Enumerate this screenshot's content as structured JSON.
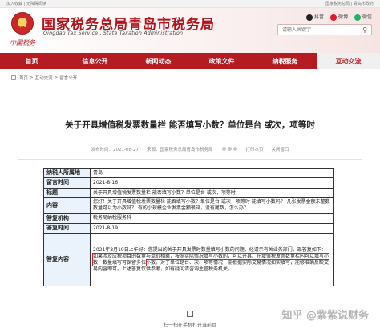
{
  "topbar": {
    "left": "加入收藏 | 无障碍阅读",
    "right": "国家税务总局 | 青岛市政府"
  },
  "header": {
    "emblem_char": "税",
    "title": "国家税务总局青岛市税务局",
    "subtitle": "Qingdao Tax Service , State Taxation Administration",
    "slogan": "中国税务",
    "social": [
      "抖音",
      "微博",
      "微信"
    ],
    "search_placeholder": "请输入关键字"
  },
  "nav": [
    "首页",
    "信息公开",
    "新闻动态",
    "政策文件",
    "纳税服务",
    "互动交流"
  ],
  "nav_active": 5,
  "breadcrumb": [
    "首页",
    ">",
    "互动交流",
    ">",
    "留言公开"
  ],
  "article": {
    "title": "关于开具增值税发票数量栏 能否填写小数？单位是台 或次，项等时",
    "date": "发布时间：2021-08-27",
    "source": "来源：国家税务总局青岛市税务局",
    "print": "打印本页",
    "close": "关闭窗口"
  },
  "table": [
    {
      "k": "纳税人所属地",
      "v": "青岛"
    },
    {
      "k": "留言时间",
      "v": "2021-8-16"
    },
    {
      "k": "标题",
      "v": "关于开具增值税发票数量栏 能否填写小数？单位是台 或次，项等时"
    },
    {
      "k": "内容",
      "v": "您好！关于开具增值税发票数量栏 能否填写小数？单位是台 或次，项等时 能填写小数吗？ 几张发票金额未整数数量可以为小数吗？ 有的小规模企业发票金额很碎，没有尾数，怎么办？"
    },
    {
      "k": "答复机构",
      "v": "税务局纳税服务科"
    },
    {
      "k": "答复时间",
      "v": "2021-8-19"
    },
    {
      "k": "答复内容",
      "v_pre": "2021年8月19日上午好：您提出的关于开具发票时数量填写小数的问题，经请示有关业务部门，现答复如下：",
      "v_hl": "如果涉及应税项目的数量与单价相乘，按照实际情况填写小数的，可以开具。在增值税发票数量栏内可以填写小数，数量填写可保留多位",
      "v_post": "小数。对于单位是台、次、项等情况，需根据实际交易情况如实填写，能够准确反映交易内容即可。上述答复仅供参考，如有疑问请咨询主管税务机关。"
    }
  ],
  "qr_caption": "扫一扫在手机打开当前页",
  "watermark": "知乎 @紫紫说财务"
}
